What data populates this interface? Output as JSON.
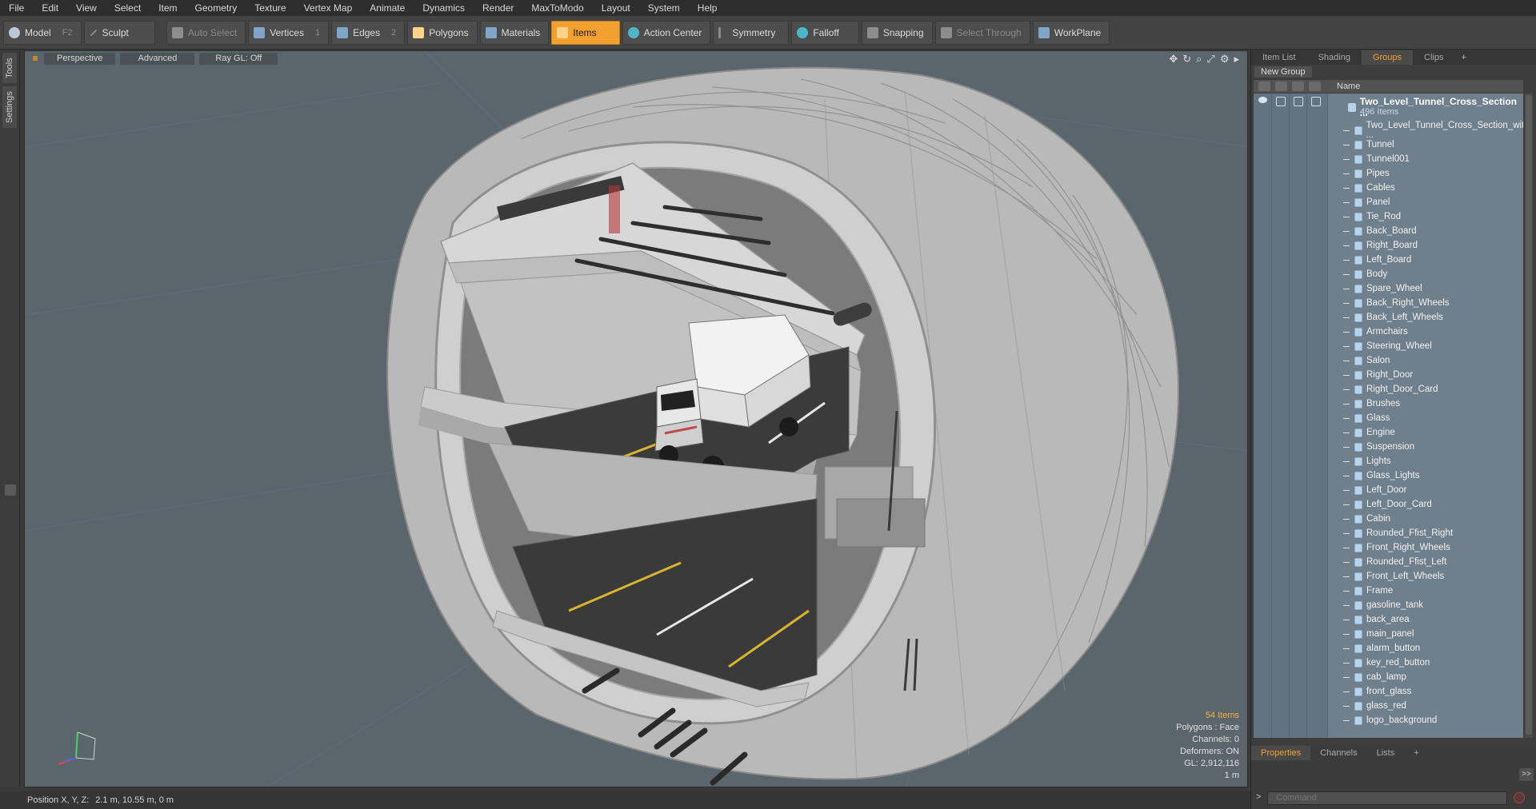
{
  "menu": [
    "File",
    "Edit",
    "View",
    "Select",
    "Item",
    "Geometry",
    "Texture",
    "Vertex Map",
    "Animate",
    "Dynamics",
    "Render",
    "MaxToModo",
    "Layout",
    "System",
    "Help"
  ],
  "toolbar": {
    "model": "Model",
    "model_key": "F2",
    "sculpt": "Sculpt",
    "auto_select": "Auto Select",
    "vertices": "Vertices",
    "vertices_key": "1",
    "edges": "Edges",
    "edges_key": "2",
    "polygons": "Polygons",
    "materials": "Materials",
    "items": "Items",
    "action_center": "Action Center",
    "symmetry": "Symmetry",
    "falloff": "Falloff",
    "snapping": "Snapping",
    "select_through": "Select Through",
    "workplane": "WorkPlane"
  },
  "left_tabs": [
    "Tools",
    "Settings"
  ],
  "viewport": {
    "view_mode": "Perspective",
    "shading": "Advanced",
    "raygl": "Ray GL: Off",
    "info": {
      "items": "54 Items",
      "polygons": "Polygons : Face",
      "channels": "Channels: 0",
      "deformers": "Deformers: ON",
      "gl": "GL: 2,912,116",
      "scale": "1 m"
    }
  },
  "status": {
    "label": "Position X, Y, Z:",
    "value": "2.1 m, 10.55 m, 0 m"
  },
  "right_panel": {
    "tabs": [
      "Item List",
      "Shading",
      "Groups",
      "Clips"
    ],
    "active_tab": "Groups",
    "new_group": "New Group",
    "column_name": "Name",
    "root": {
      "name": "Two_Level_Tunnel_Cross_Section ...",
      "count": "496 Items"
    },
    "items": [
      "Two_Level_Tunnel_Cross_Section_wit ...",
      "Tunnel",
      "Tunnel001",
      "Pipes",
      "Cables",
      "Panel",
      "Tie_Rod",
      "Back_Board",
      "Right_Board",
      "Left_Board",
      "Body",
      "Spare_Wheel",
      "Back_Right_Wheels",
      "Back_Left_Wheels",
      "Armchairs",
      "Steering_Wheel",
      "Salon",
      "Right_Door",
      "Right_Door_Card",
      "Brushes",
      "Glass",
      "Engine",
      "Suspension",
      "Lights",
      "Glass_Lights",
      "Left_Door",
      "Left_Door_Card",
      "Cabin",
      "Rounded_Ffist_Right",
      "Front_Right_Wheels",
      "Rounded_Ffist_Left",
      "Front_Left_Wheels",
      "Frame",
      "gasoline_tank",
      "back_area",
      "main_panel",
      "alarm_button",
      "key_red_button",
      "cab_lamp",
      "front_glass",
      "glass_red",
      "logo_background"
    ]
  },
  "properties_panel": {
    "tabs": [
      "Properties",
      "Channels",
      "Lists"
    ],
    "active_tab": "Properties",
    "command_placeholder": "Command",
    "expand": ">>"
  },
  "colors": {
    "accent": "#f2a030",
    "viewport_bg": "#5b656c",
    "list_bg": "#6f7f8c"
  }
}
